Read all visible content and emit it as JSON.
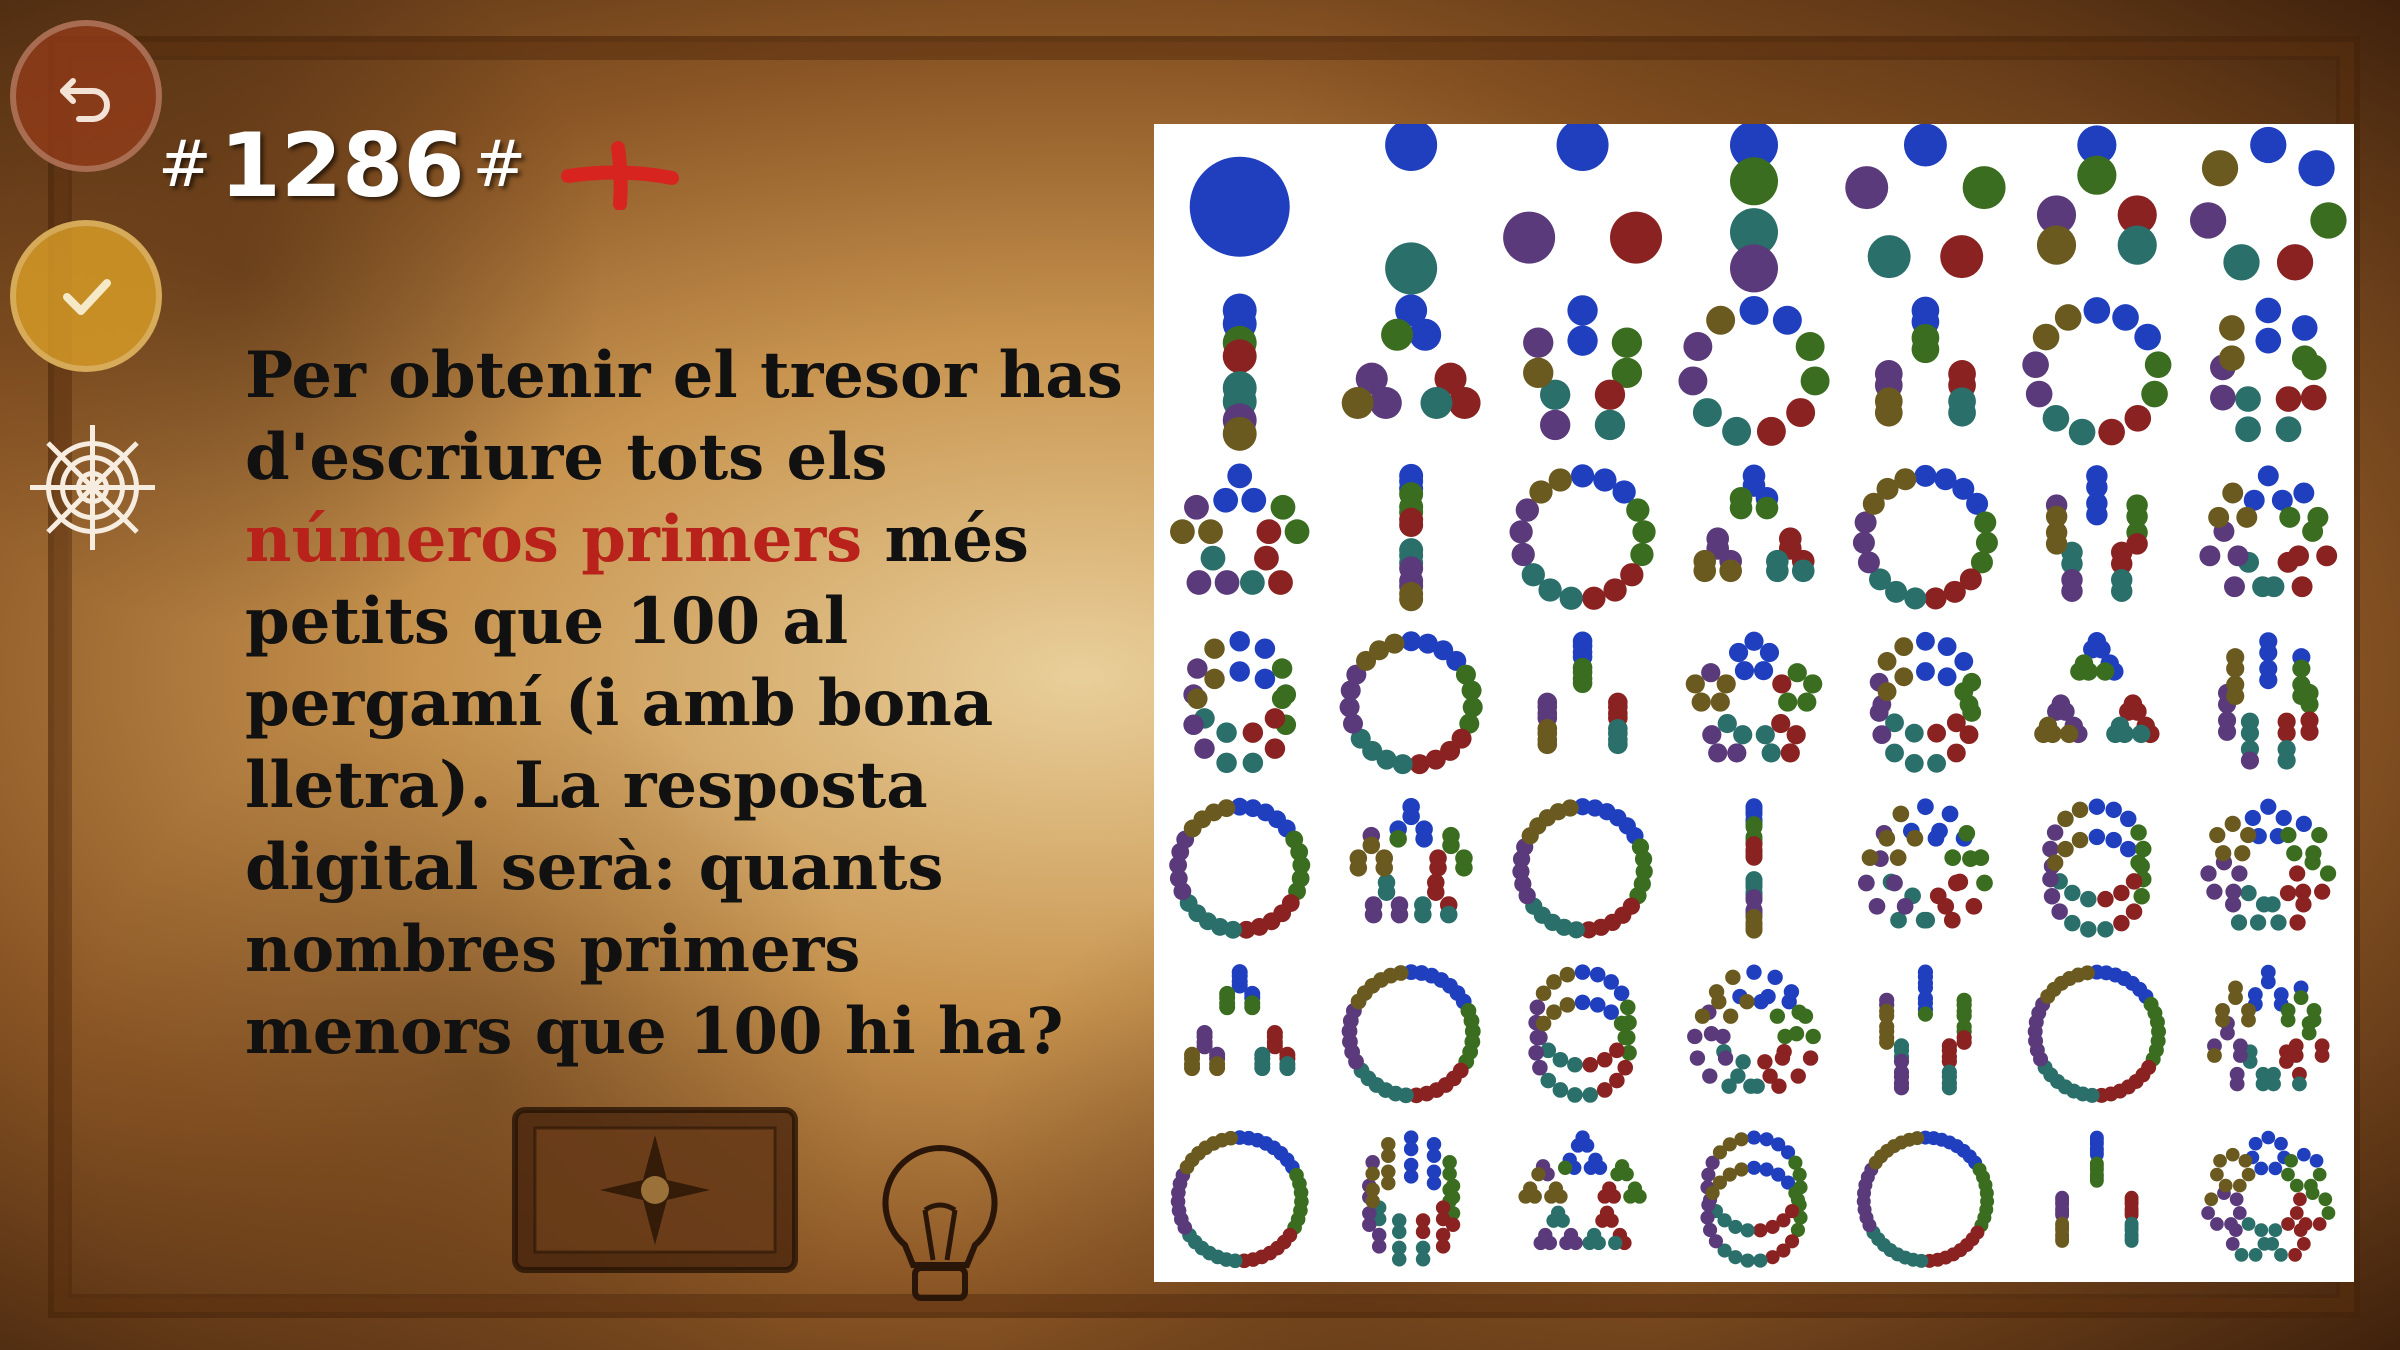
{
  "puzzle": {
    "number": "1286",
    "hash": "#"
  },
  "question": {
    "part1": "Per obtenir el tresor has d'escriure tots els ",
    "highlight": "números primers",
    "part2": " més petits que 100 al pergamí (i amb bona lletra). La resposta digital serà: quants nombres primers menors que 100 hi ha?"
  },
  "colors": {
    "highlight": "#b8221b",
    "back_button": "#a23c19",
    "check_button": "#dca028",
    "dots": [
      "#1f3fbf",
      "#3a6d1f",
      "#8a2222",
      "#2a6f6a",
      "#5a3a7a",
      "#6a5a20"
    ]
  },
  "icons": {
    "back": "undo-arrow-icon",
    "check": "checkmark-icon",
    "wheel": "ship-wheel-icon",
    "hint": "lightbulb-icon"
  },
  "factor_diagram": {
    "rows": 7,
    "cols": 7,
    "numbers_shown": "1-49"
  }
}
